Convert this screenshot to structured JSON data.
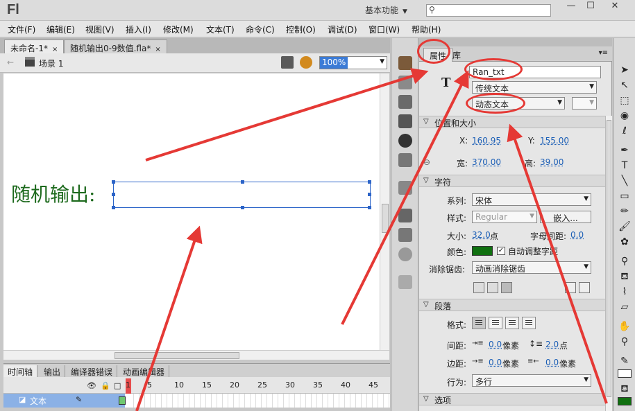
{
  "app": {
    "logo": "Fl",
    "workspace": "基本功能",
    "window_controls": [
      "—",
      "☐",
      "✕"
    ]
  },
  "menu": [
    "文件(F)",
    "编辑(E)",
    "视图(V)",
    "插入(I)",
    "修改(M)",
    "文本(T)",
    "命令(C)",
    "控制(O)",
    "调试(D)",
    "窗口(W)",
    "帮助(H)"
  ],
  "doc_tabs": [
    {
      "label": "未命名-1*",
      "close": "×"
    },
    {
      "label": "随机输出0-9数值.fla*",
      "close": "×"
    }
  ],
  "scene": {
    "label": "场景 1",
    "zoom": "100%"
  },
  "stage": {
    "label": "随机输出:"
  },
  "timeline": {
    "tabs": [
      "时间轴",
      "输出",
      "编译器错误",
      "动画编辑器"
    ],
    "frame_numbers": [
      "1",
      "5",
      "10",
      "15",
      "20",
      "25",
      "30",
      "35",
      "40",
      "45"
    ],
    "layer_name": "文本"
  },
  "properties": {
    "tabs": [
      "属性",
      "库"
    ],
    "instance_name": "Ran_txt",
    "text_engine": "传统文本",
    "text_type": "动态文本",
    "position_section": "位置和大小",
    "x_label": "X:",
    "x_value": "160.95",
    "y_label": "Y:",
    "y_value": "155.00",
    "width_label": "宽:",
    "width_value": "370.00",
    "height_label": "高:",
    "height_value": "39.00",
    "char_section": "字符",
    "family_label": "系列:",
    "family_value": "宋体",
    "style_label": "样式:",
    "style_value": "Regular",
    "embed_button": "嵌入...",
    "size_label": "大小:",
    "size_value": "32.0",
    "size_unit": "点",
    "letter_spacing_label": "字母间距:",
    "letter_spacing_value": "0.0",
    "color_label": "颜色:",
    "color_value": "#107010",
    "auto_kern_label": "自动调整字距",
    "auto_kern_checked": "✓",
    "antialias_label": "消除锯齿:",
    "antialias_value": "动画消除锯齿",
    "para_section": "段落",
    "format_label": "格式:",
    "spacing_label": "间距:",
    "indent_value": "0.0",
    "indent_unit": "像素",
    "line_spacing_value": "2.0",
    "line_spacing_unit": "点",
    "margin_label": "边距:",
    "left_margin_value": "0.0",
    "left_margin_unit": "像素",
    "right_margin_value": "0.0",
    "right_margin_unit": "像素",
    "behavior_label": "行为:",
    "behavior_value": "多行",
    "options_section": "选项"
  }
}
